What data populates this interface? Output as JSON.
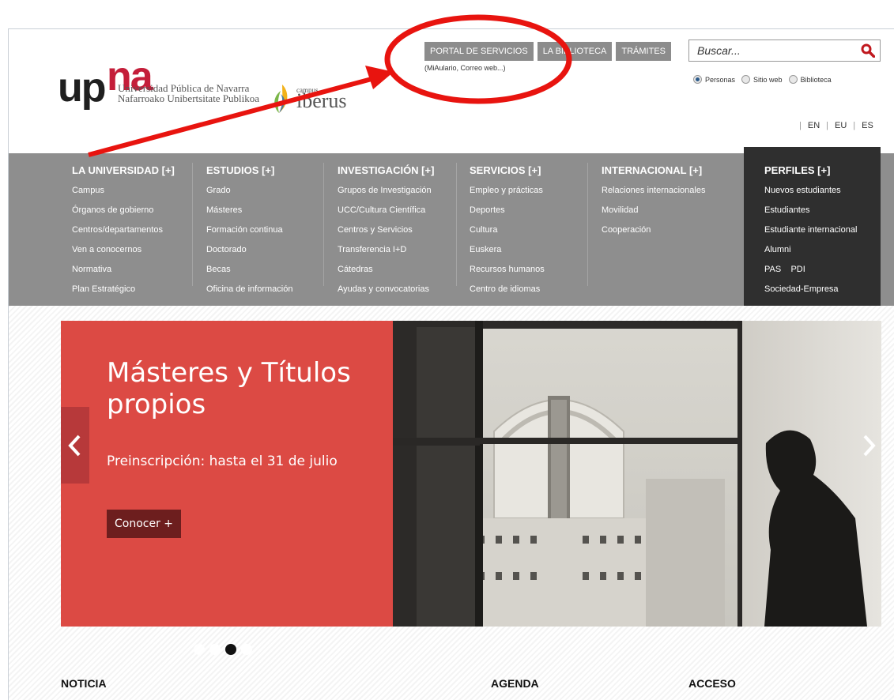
{
  "header": {
    "logo_up": "up",
    "logo_na": "na",
    "logo_sub_line1": "Universidad Pública de Navarra",
    "logo_sub_line2": "Nafarroako Unibertsitate Publikoa",
    "partner_small": "campus",
    "partner_name": "iberus",
    "top_buttons": [
      "PORTAL DE SERVICIOS",
      "LA BIBLIOTECA",
      "TRÁMITES"
    ],
    "portal_subtitle": "(MiAulario, Correo web...)",
    "search_placeholder": "Buscar...",
    "search_icon": "search-icon",
    "radio_options": [
      {
        "label": "Personas",
        "selected": true
      },
      {
        "label": "Sitio web",
        "selected": false
      },
      {
        "label": "Biblioteca",
        "selected": false
      }
    ],
    "languages": [
      "EN",
      "EU",
      "ES"
    ]
  },
  "nav": {
    "columns": [
      {
        "title": "LA UNIVERSIDAD [+]",
        "items": [
          "Campus",
          "Órganos de gobierno",
          "Centros/departamentos",
          "Ven a conocernos",
          "Normativa",
          "Plan Estratégico"
        ]
      },
      {
        "title": "ESTUDIOS [+]",
        "items": [
          "Grado",
          "Másteres",
          "Formación continua",
          "Doctorado",
          "Becas",
          "Oficina de información"
        ]
      },
      {
        "title": "INVESTIGACIÓN [+]",
        "items": [
          "Grupos de Investigación",
          "UCC/Cultura Científica",
          "Centros y Servicios",
          "Transferencia I+D",
          "Cátedras",
          "Ayudas y convocatorias"
        ]
      },
      {
        "title": "SERVICIOS [+]",
        "items": [
          "Empleo y prácticas",
          "Deportes",
          "Cultura",
          "Euskera",
          "Recursos humanos",
          "Centro de idiomas"
        ]
      },
      {
        "title": "INTERNACIONAL [+]",
        "items": [
          "Relaciones internacionales",
          "Movilidad",
          "Cooperación"
        ]
      }
    ],
    "perfiles": {
      "title": "PERFILES [+]",
      "items": [
        "Nuevos estudiantes",
        "Estudiantes",
        "Estudiante internacional",
        "Alumni",
        "PAS",
        "PDI",
        "Sociedad-Empresa"
      ]
    }
  },
  "slider": {
    "title": "Másteres y Títulos propios",
    "description": "Preinscripción: hasta el 31 de julio",
    "button": "Conocer +",
    "active_dot": 3,
    "dot_count": 4
  },
  "sections": [
    "NOTICIA",
    "AGENDA",
    "ACCESO"
  ],
  "colors": {
    "slide_red": "#dc4a44",
    "nav_gray": "#8e8e8e",
    "perfiles_bg": "#2f2f2f",
    "annotation_red": "#e8140f"
  }
}
